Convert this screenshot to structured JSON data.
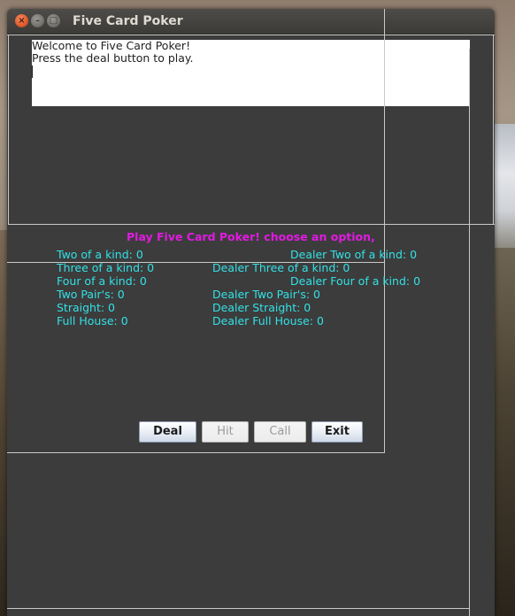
{
  "window": {
    "title": "Five Card Poker"
  },
  "message": {
    "lines": [
      "Welcome to Five Card Poker!",
      "Press the deal button to play."
    ]
  },
  "prompt": "Play Five Card Poker! choose an option,",
  "colors": {
    "prompt": "#e11ae1",
    "stats": "#33e1e6",
    "window_bg": "#3c3c3c"
  },
  "player_stats": [
    "Two of a kind: 0",
    "Three of a kind: 0",
    "Four of a kind: 0",
    "Two Pair's: 0",
    "Straight: 0",
    "Full House: 0"
  ],
  "dealer_stats": [
    "Dealer Two of a kind: 0",
    "Dealer Three of a kind: 0",
    "Dealer Four of a kind: 0",
    "Dealer Two Pair's: 0",
    "Dealer Straight: 0",
    "Dealer Full House: 0"
  ],
  "buttons": {
    "deal": "Deal",
    "hit": "Hit",
    "call": "Call",
    "exit": "Exit"
  },
  "icons": {
    "close": "close-icon",
    "minimize": "minimize-icon",
    "maximize": "maximize-icon"
  }
}
